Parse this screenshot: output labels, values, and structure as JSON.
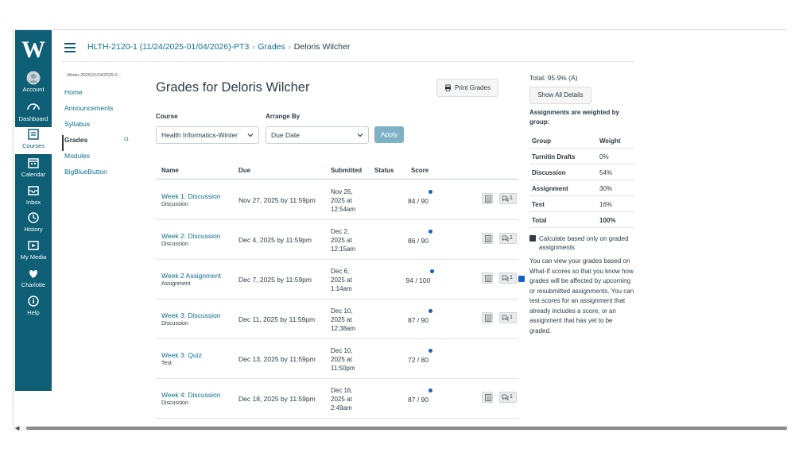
{
  "breadcrumb": {
    "course": "HLTH-2120-1 (11/24/2025-01/04/2026)-PT3",
    "section": "Grades",
    "student": "Deloris Wilcher"
  },
  "global_nav": {
    "logo": "W",
    "items": [
      {
        "label": "Account",
        "icon": "account-icon"
      },
      {
        "label": "Dashboard",
        "icon": "dashboard-icon"
      },
      {
        "label": "Courses",
        "icon": "courses-icon"
      },
      {
        "label": "Calendar",
        "icon": "calendar-icon"
      },
      {
        "label": "Inbox",
        "icon": "inbox-icon"
      },
      {
        "label": "History",
        "icon": "history-icon"
      },
      {
        "label": "My Media",
        "icon": "my-media-icon"
      },
      {
        "label": "Charlotte",
        "icon": "charlotte-icon"
      },
      {
        "label": "Help",
        "icon": "help-icon"
      }
    ]
  },
  "course_nav": {
    "term": "Winter 2025(11/24/2025-0...",
    "items": [
      {
        "label": "Home"
      },
      {
        "label": "Announcements"
      },
      {
        "label": "Syllabus"
      },
      {
        "label": "Grades",
        "badge": "11"
      },
      {
        "label": "Modules"
      },
      {
        "label": "BigBlueButton"
      }
    ]
  },
  "main": {
    "title": "Grades for Deloris Wilcher",
    "print_label": "Print Grades",
    "course_label": "Course",
    "course_value": "Health Informatics-Winter",
    "arrange_label": "Arrange By",
    "arrange_value": "Due Date",
    "apply_label": "Apply"
  },
  "table": {
    "headers": {
      "name": "Name",
      "due": "Due",
      "submitted": "Submitted",
      "status": "Status",
      "score": "Score"
    },
    "rows": [
      {
        "name": "Week 1: Discussion",
        "type": "Discussion",
        "due": "Nov 27, 2025 by 11:59pm",
        "sub1": "Nov 26,",
        "sub2": "2025 at",
        "sub3": "12:54am",
        "score": "84 / 90",
        "comments": "1"
      },
      {
        "name": "Week 2: Discussion",
        "type": "Discussion",
        "due": "Dec 4, 2025 by 11:59pm",
        "sub1": "Dec 2,",
        "sub2": "2025 at",
        "sub3": "12:15am",
        "score": "86 / 90",
        "comments": "1"
      },
      {
        "name": "Week 2 Assignment",
        "type": "Assignment",
        "due": "Dec 7, 2025 by 11:59pm",
        "sub1": "Dec 6,",
        "sub2": "2025 at",
        "sub3": "1:14am",
        "score": "94 / 100",
        "comments": "1"
      },
      {
        "name": "Week 3: Discussion",
        "type": "Discussion",
        "due": "Dec 11, 2025 by 11:59pm",
        "sub1": "Dec 10,",
        "sub2": "2025 at",
        "sub3": "12:38am",
        "score": "87 / 90",
        "comments": "1"
      },
      {
        "name": "Week 3: Quiz",
        "type": "Test",
        "due": "Dec 13, 2025 by 11:59pm",
        "sub1": "Dec 10,",
        "sub2": "2025 at",
        "sub3": "11:50pm",
        "score": "72 / 80",
        "comments": ""
      },
      {
        "name": "Week 4: Discussion",
        "type": "Discussion",
        "due": "Dec 18, 2025 by 11:59pm",
        "sub1": "Dec 16,",
        "sub2": "2025 at",
        "sub3": "2:49am",
        "score": "87 / 90",
        "comments": "1"
      }
    ]
  },
  "sidebar": {
    "total": "Total: 95.9% (A)",
    "show_all_label": "Show All Details",
    "weighted_text": "Assignments are weighted by group:",
    "weights_header": {
      "group": "Group",
      "weight": "Weight"
    },
    "weights": [
      {
        "group": "Turnitin Drafts",
        "weight": "0%"
      },
      {
        "group": "Discussion",
        "weight": "54%"
      },
      {
        "group": "Assignment",
        "weight": "30%"
      },
      {
        "group": "Test",
        "weight": "16%"
      },
      {
        "group": "Total",
        "weight": "100%"
      }
    ],
    "calc_label": "Calculate based only on graded assignments",
    "calc_checked": true,
    "whatif_text": "You can view your grades based on What-If scores so that you know how grades will be affected by upcoming or resubmitted assignments. You can test scores for an assignment that already includes a score, or an assignment that has yet to be graded."
  },
  "colors": {
    "nav_bg": "#0e5e75",
    "link": "#0e6f8c",
    "unread_dot": "#1a60c7"
  }
}
